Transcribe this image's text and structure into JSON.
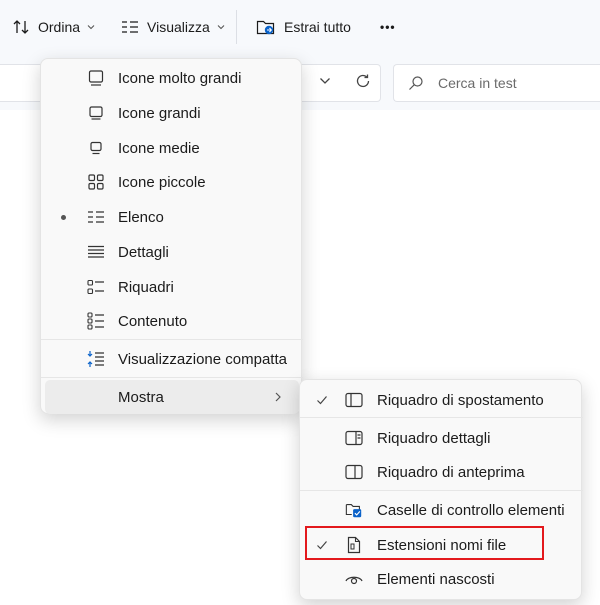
{
  "toolbar": {
    "sort_label": "Ordina",
    "view_label": "Visualizza",
    "extract_label": "Estrai tutto",
    "more_label": "•••"
  },
  "search": {
    "placeholder": "Cerca in test"
  },
  "view_menu": {
    "items": [
      {
        "label": "Icone molto grandi",
        "icon": "monitor-large-icon"
      },
      {
        "label": "Icone grandi",
        "icon": "monitor-icon"
      },
      {
        "label": "Icone medie",
        "icon": "monitor-small-icon"
      },
      {
        "label": "Icone piccole",
        "icon": "grid-icon"
      },
      {
        "label": "Elenco",
        "icon": "list-icon",
        "selected": true
      },
      {
        "label": "Dettagli",
        "icon": "details-icon"
      },
      {
        "label": "Riquadri",
        "icon": "tiles-icon"
      },
      {
        "label": "Contenuto",
        "icon": "content-icon"
      },
      {
        "label": "Visualizzazione compatta",
        "icon": "compact-icon"
      },
      {
        "label": "Mostra",
        "icon": "",
        "has_submenu": true
      }
    ]
  },
  "show_submenu": {
    "items": [
      {
        "label": "Riquadro di spostamento",
        "checked": true,
        "icon": "navigation-pane-icon"
      },
      {
        "label": "Riquadro dettagli",
        "checked": false,
        "icon": "details-pane-icon"
      },
      {
        "label": "Riquadro di anteprima",
        "checked": false,
        "icon": "preview-pane-icon"
      },
      {
        "label": "Caselle di controllo elementi",
        "checked": false,
        "icon": "checkbox-folder-icon"
      },
      {
        "label": "Estensioni nomi file",
        "checked": true,
        "icon": "file-extension-icon",
        "highlighted": true
      },
      {
        "label": "Elementi nascosti",
        "checked": false,
        "icon": "eye-icon"
      }
    ]
  },
  "colors": {
    "accent": "#0a62c9",
    "highlight": "#e3191d",
    "toolbar_bg": "#f7f9fc"
  }
}
